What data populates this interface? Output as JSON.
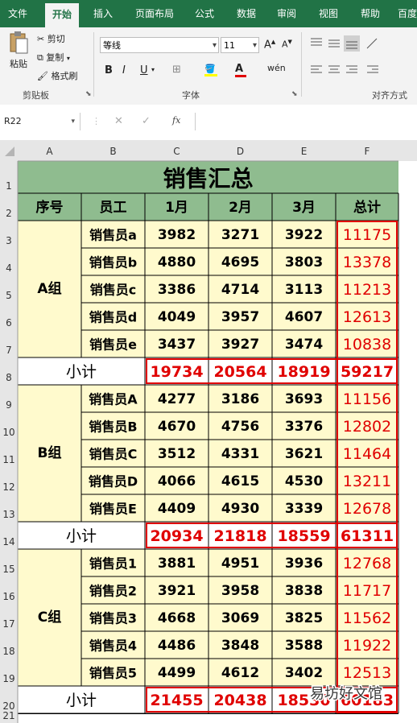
{
  "ribbon_tabs": [
    "文件",
    "开始",
    "插入",
    "页面布局",
    "公式",
    "数据",
    "审阅",
    "视图",
    "帮助",
    "百度"
  ],
  "active_tab": "开始",
  "clipboard": {
    "paste": "粘贴",
    "cut": "剪切",
    "copy": "复制",
    "format_painter": "格式刷",
    "group": "剪贴板"
  },
  "font": {
    "name": "等线",
    "size": "11",
    "bold": "B",
    "italic": "I",
    "underline": "U",
    "group": "字体"
  },
  "alignment": {
    "group": "对齐方式"
  },
  "name_box": "R22",
  "formula_icons": {
    "cancel": "✕",
    "enter": "✓",
    "fx": "fx"
  },
  "columns": [
    "A",
    "B",
    "C",
    "D",
    "E",
    "F"
  ],
  "rows": [
    "1",
    "2",
    "3",
    "4",
    "5",
    "6",
    "7",
    "8",
    "9",
    "10",
    "11",
    "12",
    "13",
    "14",
    "15",
    "16",
    "17",
    "18",
    "19",
    "20",
    "21"
  ],
  "sheet": {
    "title": "销售汇总",
    "headers": [
      "序号",
      "员工",
      "1月",
      "2月",
      "3月",
      "总计"
    ],
    "groups": [
      {
        "name": "A组",
        "rows": [
          {
            "name": "销售员a",
            "m1": "3982",
            "m2": "3271",
            "m3": "3922",
            "total": "11175"
          },
          {
            "name": "销售员b",
            "m1": "4880",
            "m2": "4695",
            "m3": "3803",
            "total": "13378"
          },
          {
            "name": "销售员c",
            "m1": "3386",
            "m2": "4714",
            "m3": "3113",
            "total": "11213"
          },
          {
            "name": "销售员d",
            "m1": "4049",
            "m2": "3957",
            "m3": "4607",
            "total": "12613"
          },
          {
            "name": "销售员e",
            "m1": "3437",
            "m2": "3927",
            "m3": "3474",
            "total": "10838"
          }
        ],
        "subtotal": {
          "label": "小计",
          "m1": "19734",
          "m2": "20564",
          "m3": "18919",
          "total": "59217"
        }
      },
      {
        "name": "B组",
        "rows": [
          {
            "name": "销售员A",
            "m1": "4277",
            "m2": "3186",
            "m3": "3693",
            "total": "11156"
          },
          {
            "name": "销售员B",
            "m1": "4670",
            "m2": "4756",
            "m3": "3376",
            "total": "12802"
          },
          {
            "name": "销售员C",
            "m1": "3512",
            "m2": "4331",
            "m3": "3621",
            "total": "11464"
          },
          {
            "name": "销售员D",
            "m1": "4066",
            "m2": "4615",
            "m3": "4530",
            "total": "13211"
          },
          {
            "name": "销售员E",
            "m1": "4409",
            "m2": "4930",
            "m3": "3339",
            "total": "12678"
          }
        ],
        "subtotal": {
          "label": "小计",
          "m1": "20934",
          "m2": "21818",
          "m3": "18559",
          "total": "61311"
        }
      },
      {
        "name": "C组",
        "rows": [
          {
            "name": "销售员1",
            "m1": "3881",
            "m2": "4951",
            "m3": "3936",
            "total": "12768"
          },
          {
            "name": "销售员2",
            "m1": "3921",
            "m2": "3958",
            "m3": "3838",
            "total": "11717"
          },
          {
            "name": "销售员3",
            "m1": "4668",
            "m2": "3069",
            "m3": "3825",
            "total": "11562"
          },
          {
            "name": "销售员4",
            "m1": "4486",
            "m2": "3848",
            "m3": "3588",
            "total": "11922"
          },
          {
            "name": "销售员5",
            "m1": "4499",
            "m2": "4612",
            "m3": "3402",
            "total": "12513"
          }
        ],
        "subtotal": {
          "label": "小计",
          "m1": "21455",
          "m2": "20438",
          "m3": "18530",
          "total": "60183"
        }
      }
    ]
  },
  "watermark": "易坊好文馆",
  "colors": {
    "accent": "#217346",
    "title_fill": "#8fbc8f",
    "body_fill": "#fffacd",
    "red": "#e00000"
  }
}
